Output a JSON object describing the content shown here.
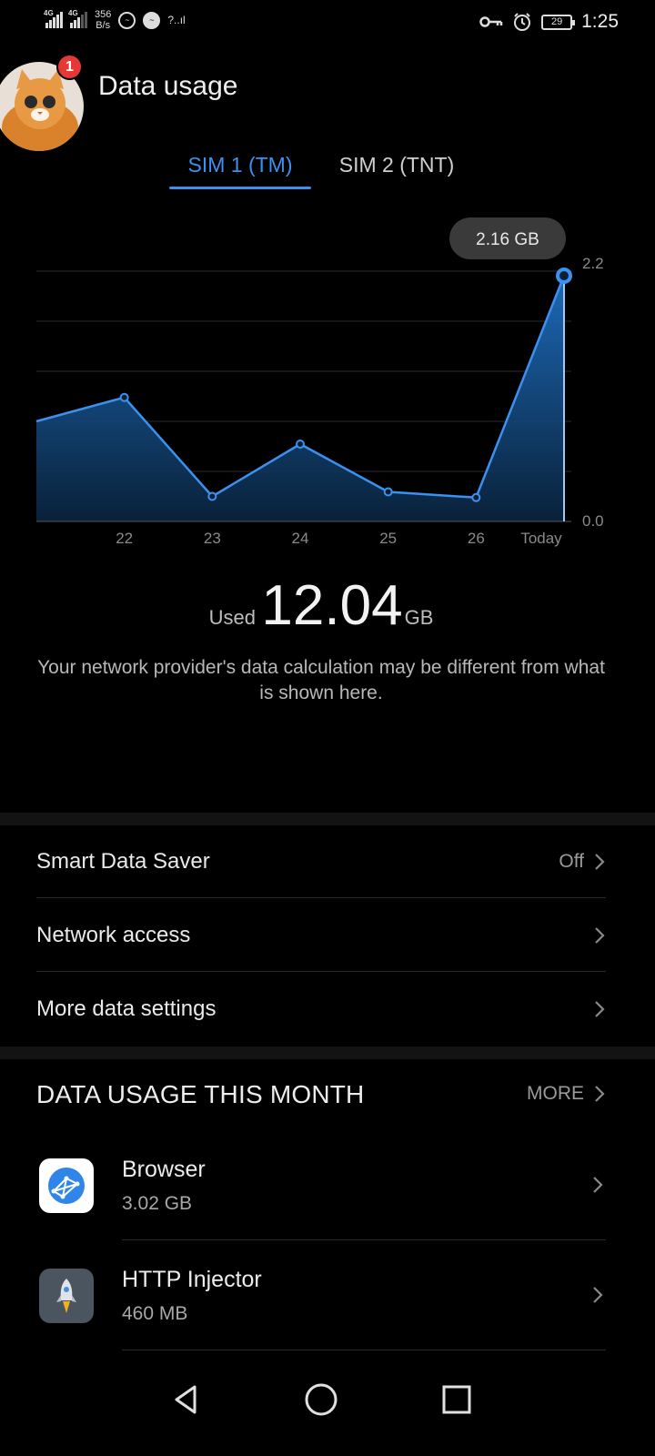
{
  "status_bar": {
    "net1": "4G",
    "net2": "4G",
    "speed_value": "356",
    "speed_unit": "B/s",
    "battery": "29",
    "time": "1:25",
    "icons": [
      "signal-icon",
      "messenger-icon",
      "wifi-icon",
      "vpn-key-icon",
      "alarm-icon",
      "battery-icon"
    ]
  },
  "header": {
    "title": "Data usage",
    "notification_count": "1"
  },
  "tabs": [
    {
      "label": "SIM 1 (TM)",
      "active": true
    },
    {
      "label": "SIM 2 (TNT)",
      "active": false
    }
  ],
  "accent_color": "#3b91f0",
  "chart_data": {
    "type": "area",
    "x": [
      "21",
      "22",
      "23",
      "24",
      "25",
      "26",
      "Today"
    ],
    "x_tick_labels": [
      "22",
      "23",
      "24",
      "25",
      "26",
      "Today"
    ],
    "values": [
      0.88,
      1.09,
      0.22,
      0.68,
      0.26,
      0.21,
      2.16
    ],
    "ylim": [
      0.0,
      2.2
    ],
    "y_tick_labels": [
      "2.2",
      "0.0"
    ],
    "highlight_label": "2.16 GB",
    "grid": true
  },
  "usage": {
    "used_label": "Used",
    "value": "12.04",
    "unit": "GB",
    "disclaimer": "Your network provider's data calculation may be different from what is shown here."
  },
  "settings": [
    {
      "label": "Smart Data Saver",
      "value": "Off"
    },
    {
      "label": "Network access",
      "value": ""
    },
    {
      "label": "More data settings",
      "value": ""
    }
  ],
  "month_section": {
    "title": "DATA USAGE THIS MONTH",
    "more_label": "MORE",
    "apps": [
      {
        "name": "Browser",
        "size": "3.02 GB",
        "icon": "browser-icon"
      },
      {
        "name": "HTTP Injector",
        "size": "460 MB",
        "icon": "http-injector-icon"
      }
    ]
  },
  "nav": [
    "back-icon",
    "home-icon",
    "recents-icon"
  ]
}
